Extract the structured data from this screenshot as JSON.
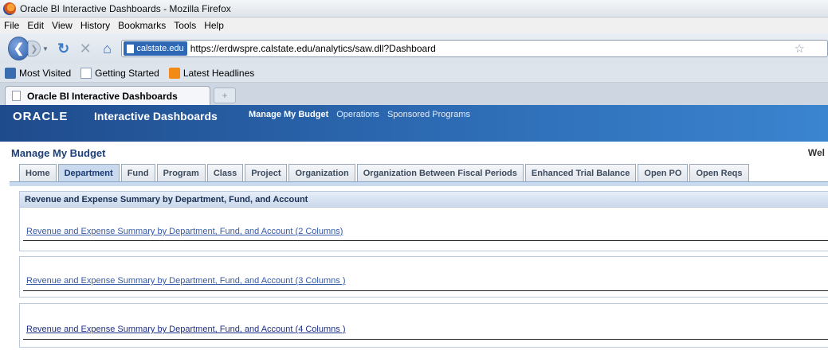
{
  "window": {
    "title": "Oracle BI Interactive Dashboards - Mozilla Firefox"
  },
  "menubar": {
    "items": [
      "File",
      "Edit",
      "View",
      "History",
      "Bookmarks",
      "Tools",
      "Help"
    ]
  },
  "navbar": {
    "site_badge": "calstate.edu",
    "url": "https://erdwspre.calstate.edu/analytics/saw.dll?Dashboard"
  },
  "bookmarks": {
    "items": [
      "Most Visited",
      "Getting Started",
      "Latest Headlines"
    ]
  },
  "tabs": {
    "active_label": "Oracle BI Interactive Dashboards",
    "new_tab_label": "+"
  },
  "oracle": {
    "logo": "ORACLE",
    "product": "Interactive Dashboards",
    "nav": [
      "Manage My Budget",
      "Operations",
      "Sponsored Programs"
    ]
  },
  "dashboard": {
    "title": "Manage My Budget",
    "welcome": "Wel",
    "tabs": [
      "Home",
      "Department",
      "Fund",
      "Program",
      "Class",
      "Project",
      "Organization",
      "Organization Between Fiscal Periods",
      "Enhanced Trial Balance",
      "Open PO",
      "Open Reqs"
    ],
    "active_tab": "Department",
    "section_title": "Revenue and Expense Summary by Department, Fund, and Account",
    "links": [
      "Revenue and Expense Summary by Department, Fund, and Account (2 Columns)",
      "Revenue and Expense Summary by Department, Fund, and Account (3 Columns )",
      "Revenue and Expense Summary by Department, Fund, and Account (4 Columns )"
    ]
  },
  "colors": {
    "oracle_header": "#2d6cb5",
    "dashboard_title": "#1e3f77",
    "link": "#3559a8",
    "tab_active": "#c9d9ee"
  }
}
